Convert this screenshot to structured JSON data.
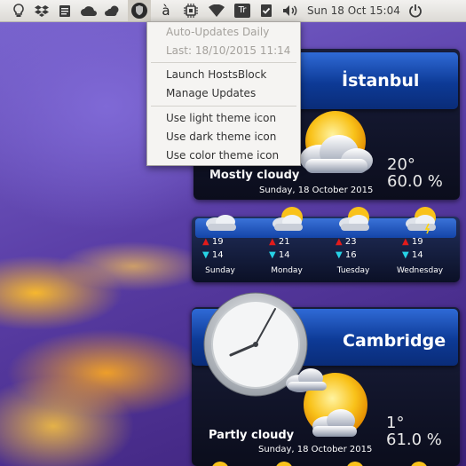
{
  "panel": {
    "icons": [
      "lightbulb-icon",
      "dropbox-icon",
      "clipboard-icon",
      "cloud-icon",
      "weather-icon",
      "hostsblock-shield-icon",
      "accent-a-icon",
      "chip-icon",
      "wifi-icon",
      "keyboard-layout-icon",
      "checklist-icon",
      "volume-icon",
      "power-icon"
    ],
    "keyboard_label": "Tr",
    "accent_label": "à",
    "clock": "Sun 18 Oct 15:04"
  },
  "menu": {
    "items": [
      {
        "label": "Auto-Updates Daily",
        "enabled": false
      },
      {
        "label": "Last: 18/10/2015 11:14",
        "enabled": false
      },
      {
        "label": "Launch HostsBlock",
        "enabled": true
      },
      {
        "label": "Manage Updates",
        "enabled": true
      },
      {
        "label": "Use light theme icon",
        "enabled": true
      },
      {
        "label": "Use dark theme icon",
        "enabled": true
      },
      {
        "label": "Use color theme icon",
        "enabled": true
      }
    ]
  },
  "istanbul": {
    "city": "İstanbul",
    "condition": "Mostly cloudy",
    "temp": "20°",
    "humidity": "60.0 %",
    "date": "Sunday, 18 October 2015"
  },
  "forecast": [
    {
      "day": "Sunday",
      "high": "19",
      "low": "14",
      "icon": "cloud-icon"
    },
    {
      "day": "Monday",
      "high": "21",
      "low": "14",
      "icon": "sun-cloud-icon"
    },
    {
      "day": "Tuesday",
      "high": "23",
      "low": "16",
      "icon": "sun-cloud-icon"
    },
    {
      "day": "Wednesday",
      "high": "19",
      "low": "14",
      "icon": "storm-icon"
    }
  ],
  "cambridge": {
    "city": "Cambridge",
    "condition": "Partly cloudy",
    "temp": "1°",
    "humidity": "61.0 %",
    "date": "Sunday, 18 October 2015"
  },
  "colors": {
    "accent_blue": "#1c52c0",
    "high_arrow": "#e21b1b",
    "low_arrow": "#27d3e6"
  }
}
